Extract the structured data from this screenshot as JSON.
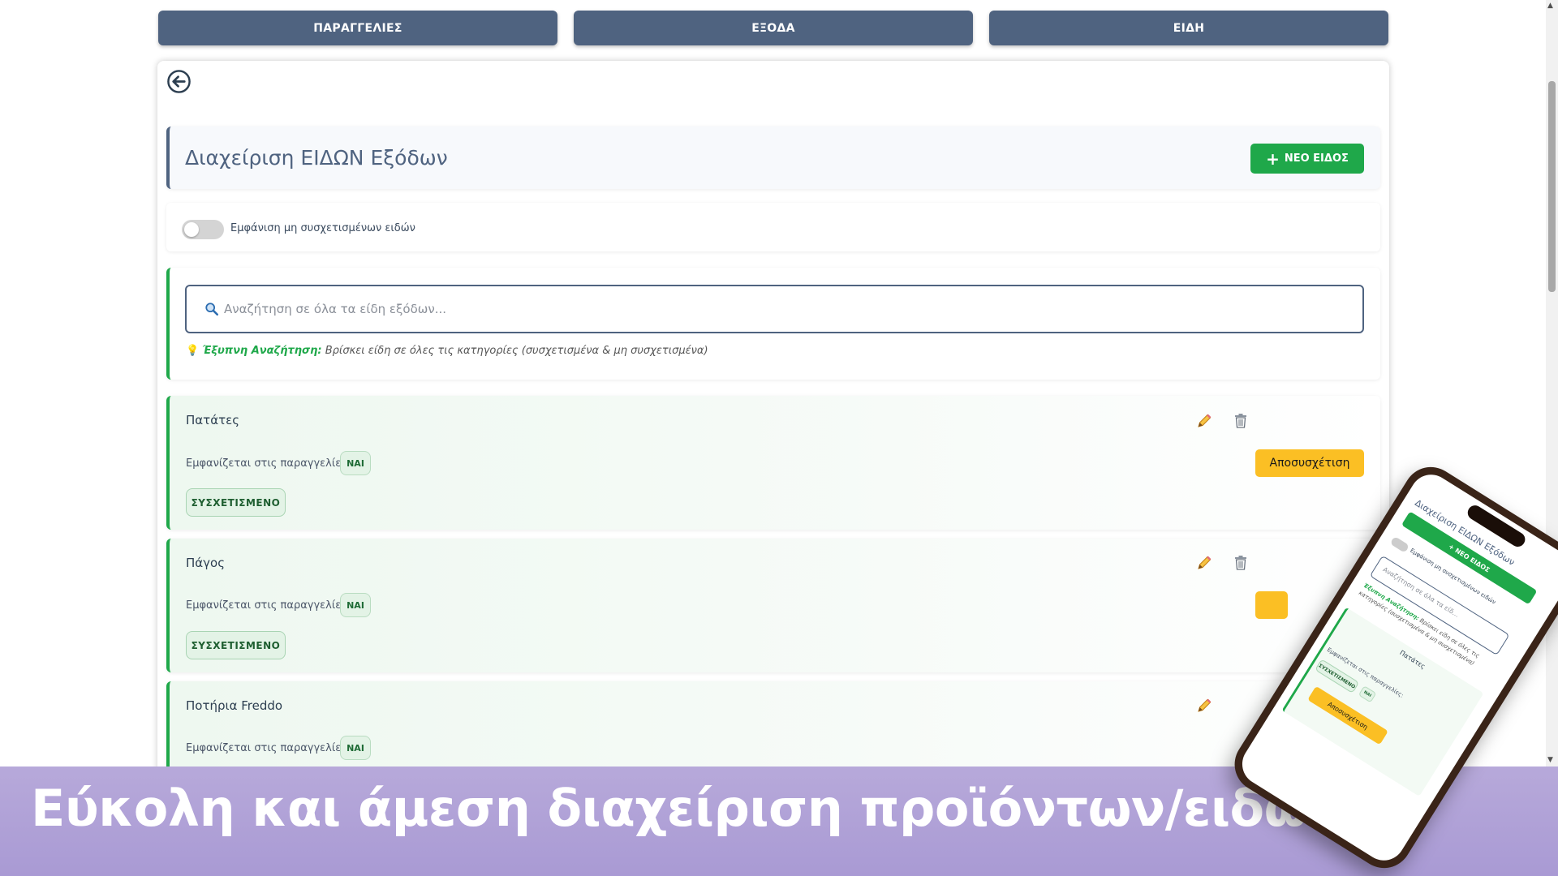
{
  "nav": {
    "items": [
      {
        "label": "ΠΑΡΑΓΓΕΛΙΕΣ"
      },
      {
        "label": "ΕΞΟΔΑ"
      },
      {
        "label": "ΕΙΔΗ"
      }
    ]
  },
  "header": {
    "title": "Διαχείριση ΕΙΔΩΝ Εξόδων",
    "new_button_label": "ΝΕΟ ΕΙΔΟΣ"
  },
  "filter": {
    "toggle_label": "Εμφάνιση μη συσχετισμένων ειδών"
  },
  "search": {
    "placeholder": "Αναζήτηση σε όλα τα είδη εξόδων...",
    "hint_title": "Έξυπνη Αναζήτηση:",
    "hint_text": " Βρίσκει είδη σε όλες τις κατηγορίες (συσχετισμένα & μη συσχετισμένα)"
  },
  "items": [
    {
      "name": "Πατάτες",
      "meta_label": "Εμφανίζεται στις παραγγελίες:",
      "visible": "ΝΑΙ",
      "status": "ΣΥΣΧΕΤΙΣΜΕΝΟ",
      "action_label": "Αποσυσχέτιση"
    },
    {
      "name": "Πάγος",
      "meta_label": "Εμφανίζεται στις παραγγελίες:",
      "visible": "ΝΑΙ",
      "status": "ΣΥΣΧΕΤΙΣΜΕΝΟ"
    },
    {
      "name": "Ποτήρια Freddo",
      "meta_label": "Εμφανίζεται στις παραγγελίες:",
      "visible": "ΝΑΙ"
    }
  ],
  "banner": {
    "text": "Εύκολη και άμεση διαχείριση προϊόντων/ειδών"
  },
  "phone": {
    "title": "Διαχείριση ΕΙΔΩΝ Εξόδων",
    "new_button_label": "+ ΝΕΟ ΕΙΔΟΣ",
    "toggle_label": "Εμφάνιση μη συσχετισμένων ειδών",
    "search_placeholder": "Αναζήτηση σε όλα τα είδ...",
    "hint_title": "Έξυπνη Αναζήτηση:",
    "hint_text": " Βρίσκει είδη σε όλες τις κατηγορίες (συσχετισμένα & μη συσχετισμένα)",
    "item_name": "Πατάτες",
    "item_meta": "Εμφανίζεται στις παραγγελίες:",
    "visible": "ΝΑΙ",
    "status": "ΣΥΣΧΕΤΙΣΜΕΝΟ",
    "action_label": "Αποσυσχέτιση"
  },
  "colors": {
    "nav": "#4f6380",
    "accent_green": "#1fa84a",
    "action_yellow": "#fbbf24",
    "banner": "#b0a1d7"
  }
}
